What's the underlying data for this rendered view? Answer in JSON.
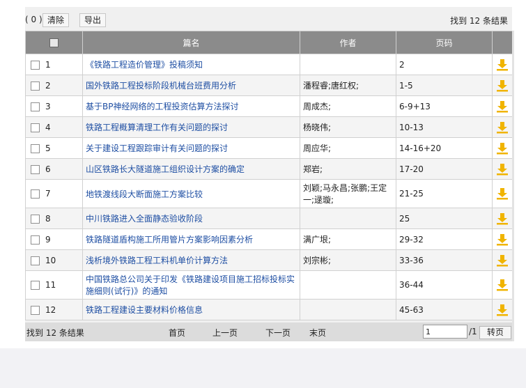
{
  "toolbar": {
    "selected_count": "( 0 )",
    "clear_label": "清除",
    "export_label": "导出",
    "result_summary": "找到 12 条结果"
  },
  "table": {
    "headers": {
      "title": "篇名",
      "author": "作者",
      "pages": "页码"
    },
    "rows": [
      {
        "num": "1",
        "title": "《铁路工程造价管理》投稿须知",
        "author": "",
        "pages": "2"
      },
      {
        "num": "2",
        "title": "国外铁路工程投标阶段机械台班费用分析",
        "author": "潘程睿;唐红权;",
        "pages": "1-5"
      },
      {
        "num": "3",
        "title": "基于BP神经网络的工程投资估算方法探讨",
        "author": "周成杰;",
        "pages": "6-9+13"
      },
      {
        "num": "4",
        "title": "铁路工程概算清理工作有关问题的探讨",
        "author": "杨晓伟;",
        "pages": "10-13"
      },
      {
        "num": "5",
        "title": "关于建设工程跟踪审计有关问题的探讨",
        "author": "周应华;",
        "pages": "14-16+20"
      },
      {
        "num": "6",
        "title": "山区铁路长大隧道施工组织设计方案的确定",
        "author": "郑岩;",
        "pages": "17-20"
      },
      {
        "num": "7",
        "title": "地铁渡线段大断面施工方案比较",
        "author": "刘颖;马永昌;张鹏;王定一;逯璇;",
        "pages": "21-25"
      },
      {
        "num": "8",
        "title": "中川铁路进入全面静态验收阶段",
        "author": "",
        "pages": "25"
      },
      {
        "num": "9",
        "title": "铁路隧道盾构施工所用管片方案影响因素分析",
        "author": "满广垠;",
        "pages": "29-32"
      },
      {
        "num": "10",
        "title": "浅析境外铁路工程工料机单价计算方法",
        "author": "刘宗彬;",
        "pages": "33-36"
      },
      {
        "num": "11",
        "title": "中国铁路总公司关于印发《铁路建设项目施工招标投标实施细则(试行)》的通知",
        "author": "",
        "pages": "36-44"
      },
      {
        "num": "12",
        "title": "铁路工程建设主要材料价格信息",
        "author": "",
        "pages": "45-63"
      }
    ]
  },
  "pager": {
    "summary": "找到 12 条结果",
    "first": "首页",
    "prev": "上一页",
    "next": "下一页",
    "last": "末页",
    "page_value": "1",
    "total": "/1",
    "jump_label": "转页"
  },
  "colors": {
    "header_bg": "#8b8b8b",
    "link": "#1f4fa3",
    "download_icon": "#f0b400"
  }
}
